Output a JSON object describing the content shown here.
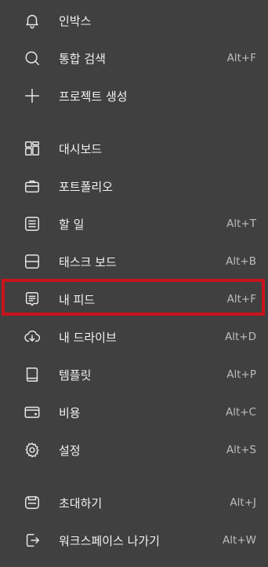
{
  "menu": {
    "items": [
      {
        "label": "인박스",
        "shortcut": "",
        "icon": "bell-icon"
      },
      {
        "label": "통합 검색",
        "shortcut": "Alt+F",
        "icon": "search-icon"
      },
      {
        "label": "프로젝트 생성",
        "shortcut": "",
        "icon": "plus-icon"
      },
      {
        "label": "대시보드",
        "shortcut": "",
        "icon": "dashboard-icon"
      },
      {
        "label": "포트폴리오",
        "shortcut": "",
        "icon": "briefcase-icon"
      },
      {
        "label": "할 일",
        "shortcut": "Alt+T",
        "icon": "list-icon"
      },
      {
        "label": "태스크 보드",
        "shortcut": "Alt+B",
        "icon": "board-icon"
      },
      {
        "label": "내 피드",
        "shortcut": "Alt+F",
        "icon": "feed-icon"
      },
      {
        "label": "내 드라이브",
        "shortcut": "Alt+D",
        "icon": "cloud-download-icon"
      },
      {
        "label": "템플릿",
        "shortcut": "Alt+P",
        "icon": "book-icon"
      },
      {
        "label": "비용",
        "shortcut": "Alt+C",
        "icon": "wallet-icon"
      },
      {
        "label": "설정",
        "shortcut": "Alt+S",
        "icon": "gear-icon"
      },
      {
        "label": "초대하기",
        "shortcut": "Alt+J",
        "icon": "invite-icon"
      },
      {
        "label": "워크스페이스 나가기",
        "shortcut": "Alt+W",
        "icon": "exit-icon"
      }
    ]
  },
  "colors": {
    "background": "#404040",
    "text": "#f2f2f2",
    "shortcut": "#bdbdbd",
    "highlight": "#c8141c"
  }
}
